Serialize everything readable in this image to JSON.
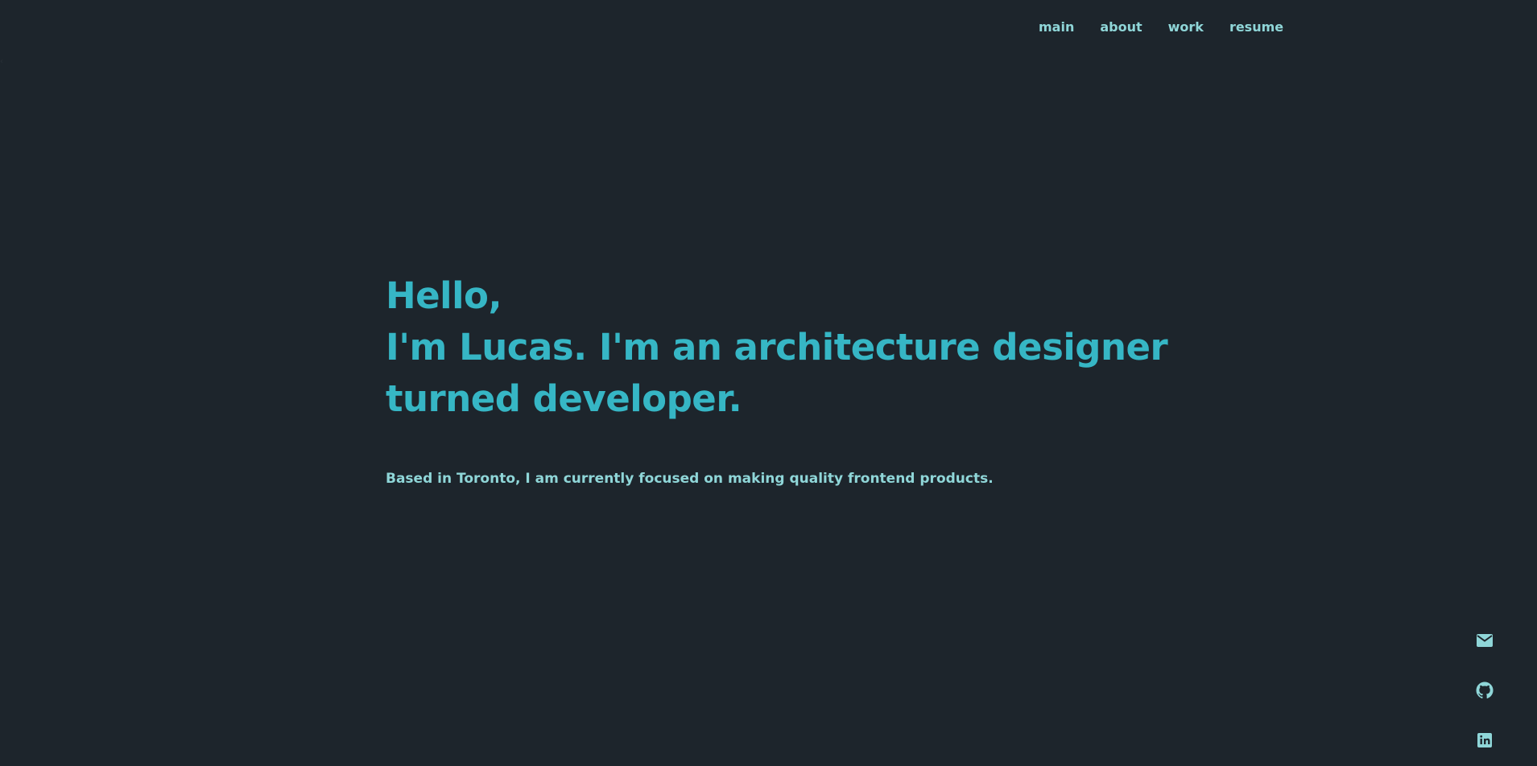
{
  "nav": {
    "items": [
      {
        "label": "main"
      },
      {
        "label": "about"
      },
      {
        "label": "work"
      },
      {
        "label": "resume"
      }
    ]
  },
  "hero": {
    "greeting": "Hello,",
    "line1": "I'm Lucas. I'm an architecture designer",
    "line2": "turned developer.",
    "subtitle": "Based in Toronto, I am currently focused on making quality frontend products."
  },
  "social": {
    "icons": [
      "mail-icon",
      "github-icon",
      "linkedin-icon"
    ]
  },
  "colors": {
    "background": "#1d252c",
    "accent": "#36b6c5",
    "text_light": "#8fd6d8"
  }
}
